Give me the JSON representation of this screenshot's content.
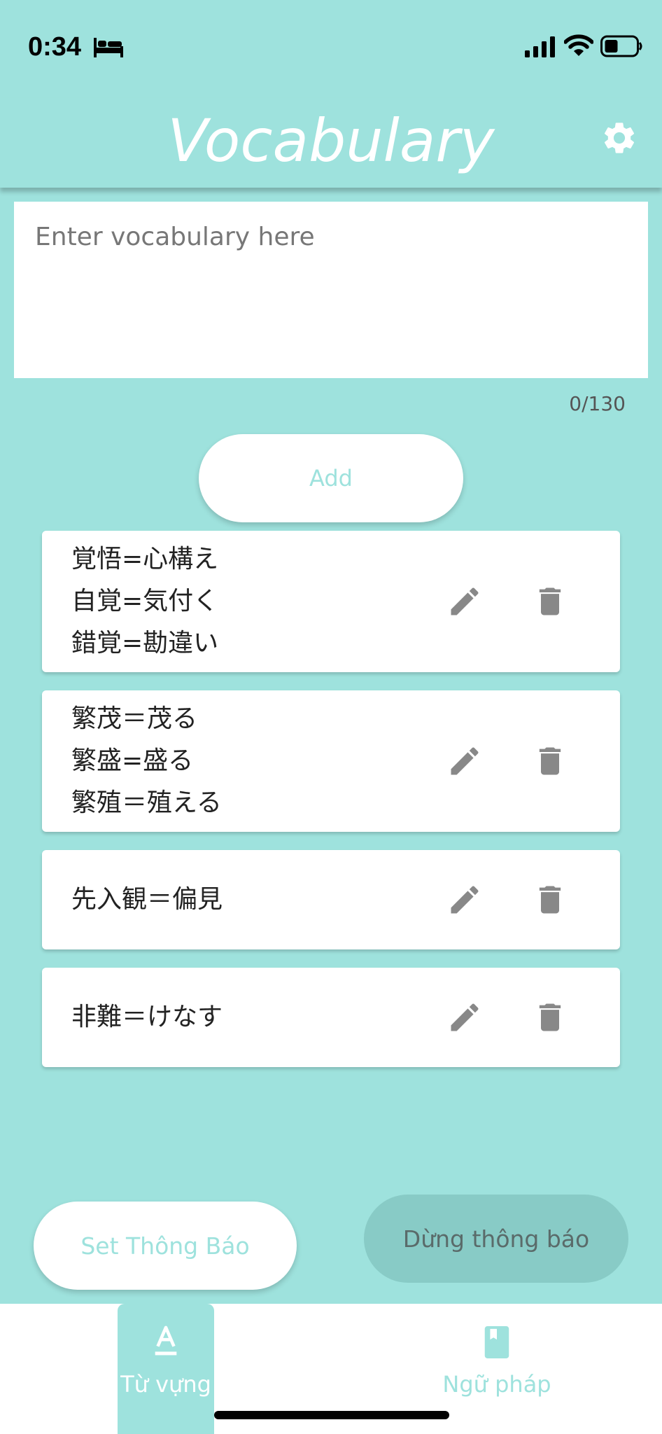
{
  "status_bar": {
    "time": "0:34"
  },
  "header": {
    "title": "Vocabulary"
  },
  "input": {
    "placeholder": "Enter vocabulary here",
    "counter": "0/130"
  },
  "buttons": {
    "add": "Add",
    "set_notification": "Set Thông Báo",
    "stop_notification": "Dừng thông báo"
  },
  "vocab_items": [
    {
      "lines": [
        "覚悟=心構え",
        "自覚=気付く",
        "錯覚=勘違い"
      ]
    },
    {
      "lines": [
        "繁茂＝茂る",
        "繁盛=盛る",
        "繁殖＝殖える"
      ]
    },
    {
      "lines": [
        "先入観＝偏見"
      ]
    },
    {
      "lines": [
        "非難＝けなす"
      ]
    }
  ],
  "nav": {
    "vocab_label": "Từ vựng",
    "grammar_label": "Ngữ pháp"
  },
  "colors": {
    "accent": "#9ee2dd",
    "icon_gray": "#888888",
    "stop_button": "#88cbc6"
  }
}
